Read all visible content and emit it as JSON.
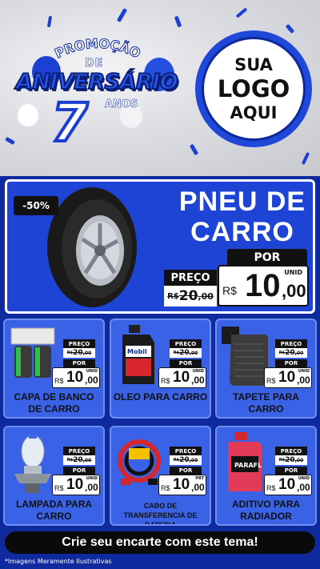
{
  "header": {
    "promo_top": "PROMOÇÃO",
    "promo_de": "DE",
    "promo_main": "ANIVERSÁRIO",
    "promo_number": "7",
    "promo_anos": "ANOS",
    "logo_line1": "SUA",
    "logo_line2": "LOGO",
    "logo_line3": "AQUI"
  },
  "featured": {
    "discount": "-50%",
    "title": "PNEU DE CARRO",
    "preco_label": "PREÇO",
    "old_currency": "R$",
    "old_int": "20",
    "old_dec": ",00",
    "por_label": "POR",
    "currency": "R$",
    "price_int": "10",
    "price_dec": ",00",
    "unit": "UNID",
    "image_icon": "car-tire-icon"
  },
  "products": [
    {
      "name": "CAPA DE BANCO DE CARRO",
      "icon": "seat-cover-icon",
      "preco_label": "PREÇO",
      "old_currency": "R$",
      "old_int": "20",
      "old_dec": ",00",
      "por_label": "POR",
      "currency": "R$",
      "price_int": "10",
      "price_dec": ",00",
      "unit": "UNID"
    },
    {
      "name": "OLEO PARA CARRO",
      "icon": "motor-oil-icon",
      "preco_label": "PREÇO",
      "old_currency": "R$",
      "old_int": "20",
      "old_dec": ",00",
      "por_label": "POR",
      "currency": "R$",
      "price_int": "10",
      "price_dec": ",00",
      "unit": "UNID"
    },
    {
      "name": "TAPETE PARA CARRO",
      "icon": "car-mat-icon",
      "preco_label": "PREÇO",
      "old_currency": "R$",
      "old_int": "20",
      "old_dec": ",00",
      "por_label": "POR",
      "currency": "R$",
      "price_int": "10",
      "price_dec": ",00",
      "unit": "UNID"
    },
    {
      "name": "LAMPADA PARA CARRO",
      "icon": "headlight-bulb-icon",
      "preco_label": "PREÇO",
      "old_currency": "R$",
      "old_int": "20",
      "old_dec": ",00",
      "por_label": "POR",
      "currency": "R$",
      "price_int": "10",
      "price_dec": ",00",
      "unit": "UNID"
    },
    {
      "name": "CABO DE TRANSFERENCIA DE BATERIA",
      "icon": "jumper-cable-icon",
      "preco_label": "PREÇO",
      "old_currency": "R$",
      "old_int": "20",
      "old_dec": ",00",
      "por_label": "POR",
      "currency": "R$",
      "price_int": "10",
      "price_dec": ",00",
      "unit": "PRT"
    },
    {
      "name": "ADITIVO PARA RADIADOR",
      "icon": "radiator-additive-icon",
      "preco_label": "PREÇO",
      "old_currency": "R$",
      "old_int": "20",
      "old_dec": ",00",
      "por_label": "POR",
      "currency": "R$",
      "price_int": "10",
      "price_dec": ",00",
      "unit": "UNID"
    }
  ],
  "footer": {
    "cta": "Crie seu encarte com este tema!",
    "disclaimer": "*Imagens Meramente Ilustrativas"
  },
  "colors": {
    "background": "#0f2a9e",
    "card": "#3a62e6",
    "featured": "#1e44d6",
    "accent": "#1f48d9"
  }
}
